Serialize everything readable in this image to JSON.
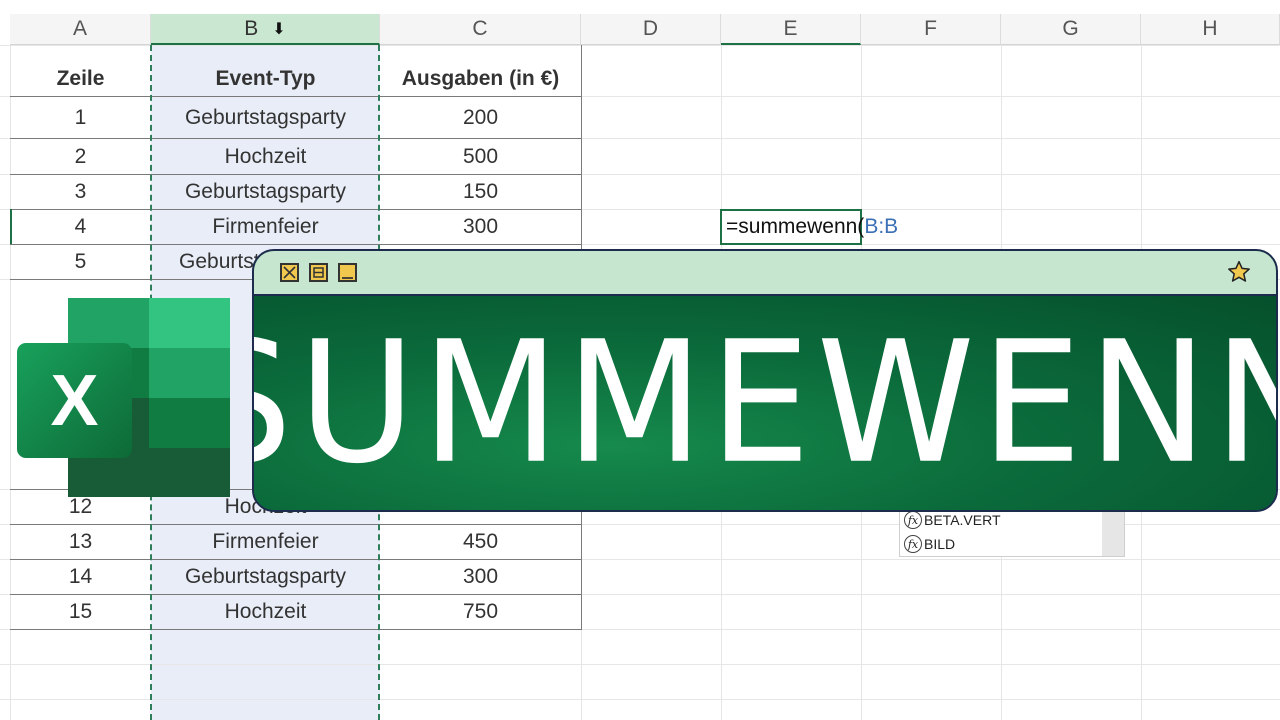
{
  "columns": [
    "A",
    "B",
    "C",
    "D",
    "E",
    "F",
    "G",
    "H"
  ],
  "table": {
    "headers": [
      "Zeile",
      "Event-Typ",
      "Ausgaben (in €)"
    ],
    "rows": [
      [
        "1",
        "Geburtstagsparty",
        "200"
      ],
      [
        "2",
        "Hochzeit",
        "500"
      ],
      [
        "3",
        "Geburtstagsparty",
        "150"
      ],
      [
        "4",
        "Firmenfeier",
        "300"
      ],
      [
        "5",
        "Geburtstagsparty",
        ""
      ],
      [
        "12",
        "Hochzeit",
        ""
      ],
      [
        "13",
        "Firmenfeier",
        "450"
      ],
      [
        "14",
        "Geburtstagsparty",
        "300"
      ],
      [
        "15",
        "Hochzeit",
        "750"
      ]
    ]
  },
  "formula": {
    "prefix": "=summewenn(",
    "ref": "B:B"
  },
  "autocomplete": {
    "items": [
      "BETA.VERT",
      "BILD"
    ]
  },
  "overlay": {
    "title": "SUMMEWENN"
  },
  "logo": {
    "letter": "X"
  },
  "colors": {
    "excel_green": "#1e7145",
    "accent_blue": "#3b6fb6",
    "selection_fill": "#e8edf7"
  }
}
